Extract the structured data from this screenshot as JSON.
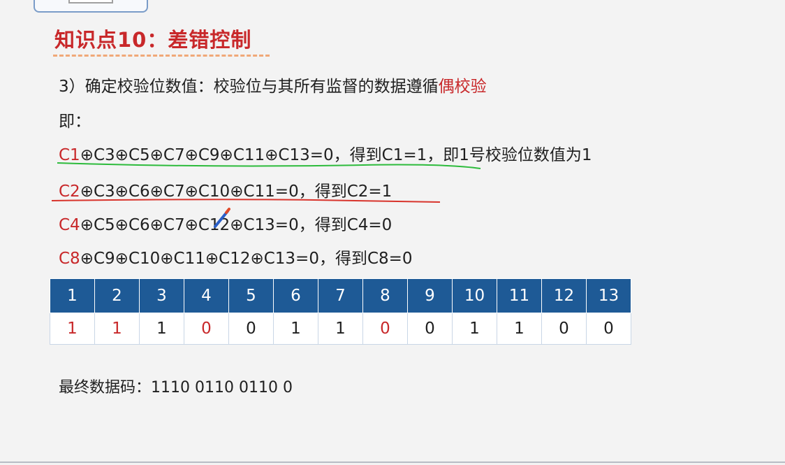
{
  "slide": {
    "title": "知识点10：差错控制",
    "step_text_a": "3）确定校验位数值：校验位与其所有监督的数据遵循",
    "step_text_b": "偶校验",
    "ie": "即：",
    "equations": [
      {
        "head": "C1",
        "rest": "⊕C3⊕C5⊕C7⊕C9⊕C11⊕C13=0，得到C1=1，即1号校验位数值为1"
      },
      {
        "head": "C2",
        "rest": "⊕C3⊕C6⊕C7⊕C10⊕C11=0，得到C2=1"
      },
      {
        "head": "C4",
        "rest": "⊕C5⊕C6⊕C7⊕C12⊕C13=0，得到C4=0"
      },
      {
        "head": "C8",
        "rest": "⊕C9⊕C10⊕C11⊕C12⊕C13=0，得到C8=0"
      }
    ],
    "table": {
      "positions": [
        "1",
        "2",
        "3",
        "4",
        "5",
        "6",
        "7",
        "8",
        "9",
        "10",
        "11",
        "12",
        "13"
      ],
      "values": [
        "1",
        "1",
        "1",
        "0",
        "0",
        "1",
        "1",
        "0",
        "0",
        "1",
        "1",
        "0",
        "0"
      ]
    },
    "final_label": "最终数据码：",
    "final_code": "1110 0110 0110 0"
  },
  "colors": {
    "accent_red": "#c8282a",
    "header_blue": "#1e5a96",
    "underline_green": "#2dbb3c",
    "underline_red": "#d8342c",
    "title_dash": "#f0a878"
  },
  "icons": [
    "pen-cursor-icon"
  ]
}
